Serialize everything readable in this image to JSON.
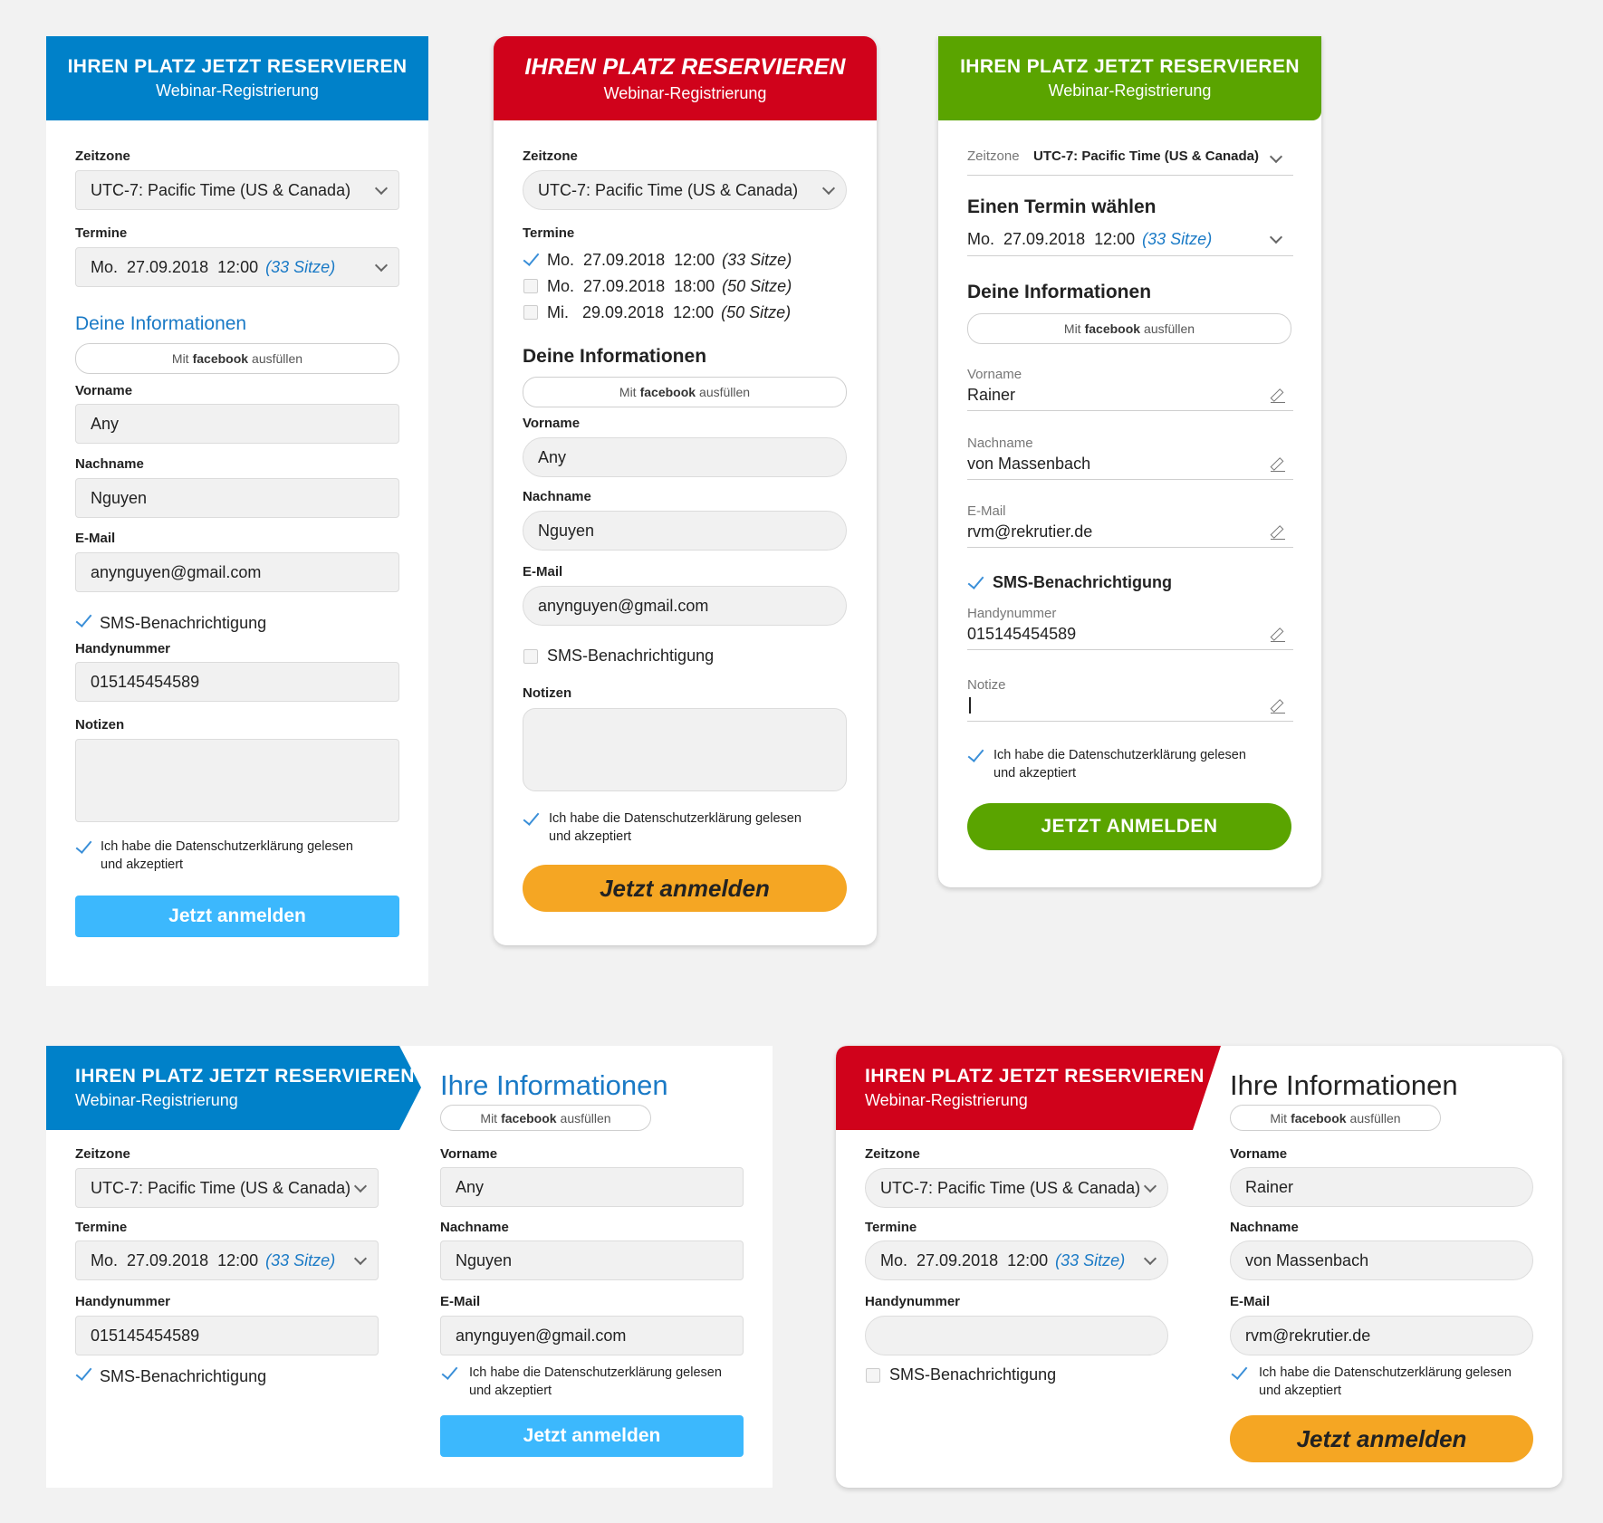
{
  "colors": {
    "blue": "#0081c9",
    "red": "#d0021b",
    "green": "#5aa400",
    "light_blue_btn": "#3cb8fd",
    "orange_btn": "#f5a623",
    "link_blue": "#1a7ac6"
  },
  "header": {
    "title_caps": "IHREN PLATZ JETZT RESERVIEREN",
    "title_short": "IHREN PLATZ RESERVIEREN",
    "subtitle": "Webinar-Registrierung"
  },
  "labels": {
    "zeitzone": "Zeitzone",
    "termine": "Termine",
    "vorname": "Vorname",
    "nachname": "Nachname",
    "email": "E-Mail",
    "handynummer": "Handynummer",
    "notizen": "Notizen",
    "notize": "Notize",
    "sms": "SMS-Benachrichtigung",
    "privacy_1": "Ich habe die Datenschutzerklärung gelesen",
    "privacy_2": "und akzeptiert",
    "fb_pre": "Mit",
    "fb_brand": "facebook",
    "fb_post": "ausfüllen",
    "deine_info": "Deine Informationen",
    "ihre_info": "Ihre Informationen",
    "einen_termin": "Einen Termin wählen"
  },
  "values": {
    "timezone": "UTC-7: Pacific Time (US & Canada)",
    "termin": "Mo.  27.09.2018  12:00",
    "seats": "(33 Sitze)",
    "first_any": "Any",
    "last_nguyen": "Nguyen",
    "email_any": "anynguyen@gmail.com",
    "phone": "015145454589",
    "first_rainer": "Rainer",
    "last_rainer": "von Massenbach",
    "email_rainer": "rvm@rekrutier.de"
  },
  "termine_list": [
    {
      "date": "Mo.  27.09.2018  18:00",
      "seats": "(50 Sitze)"
    },
    {
      "date": "Mi.   29.09.2018  12:00",
      "seats": "(50 Sitze)"
    }
  ],
  "buttons": {
    "jetzt": "Jetzt anmelden",
    "jetzt_caps": "JETZT ANMELDEN"
  }
}
